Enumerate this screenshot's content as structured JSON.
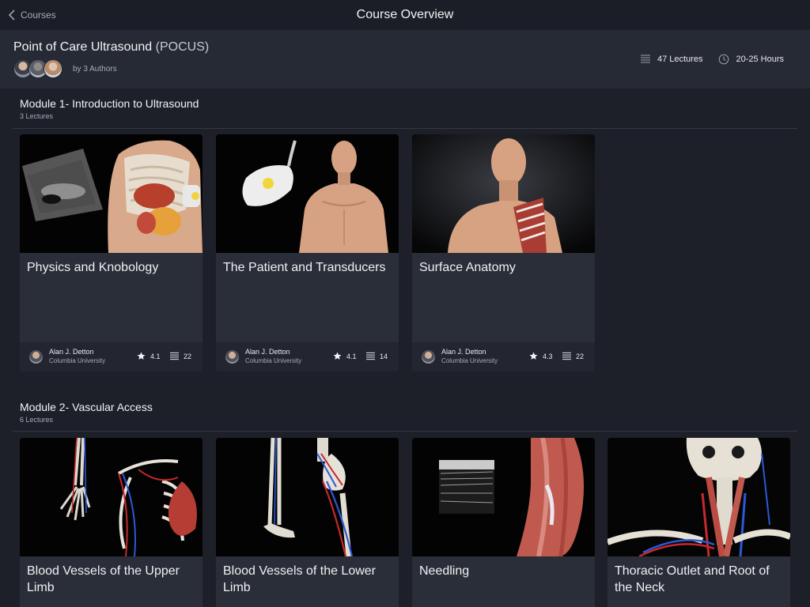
{
  "nav": {
    "back_label": "Courses",
    "title": "Course Overview"
  },
  "course": {
    "title": "Point of Care Ultrasound",
    "acronym": "(POCUS)",
    "authors_label": "by 3 Authors",
    "lectures": "47 Lectures",
    "hours": "20-25 Hours"
  },
  "modules": [
    {
      "title": "Module 1- Introduction to Ultrasound",
      "count": "3 Lectures",
      "cards": [
        {
          "title": "Physics and Knobology",
          "author": "Alan J. Detton",
          "institution": "Columbia University",
          "rating": "4.1",
          "lectures": "22",
          "image": "torso-ultrasound-scan"
        },
        {
          "title": "The Patient and Transducers",
          "author": "Alan J. Detton",
          "institution": "Columbia University",
          "rating": "4.1",
          "lectures": "14",
          "image": "transducer-and-torso"
        },
        {
          "title": "Surface Anatomy",
          "author": "Alan J. Detton",
          "institution": "Columbia University",
          "rating": "4.3",
          "lectures": "22",
          "image": "male-bust-ribcage"
        }
      ]
    },
    {
      "title": "Module 2- Vascular Access",
      "count": "6 Lectures",
      "cards": [
        {
          "title": "Blood Vessels of the Upper Limb",
          "image": "upper-limb-vessels"
        },
        {
          "title": "Blood Vessels of the Lower Limb",
          "image": "lower-limb-vessels"
        },
        {
          "title": "Needling",
          "image": "ultrasound-and-arm-muscle"
        },
        {
          "title": "Thoracic Outlet and Root of the Neck",
          "image": "skull-neck-vessels"
        }
      ]
    }
  ],
  "colors": {
    "background": "#1d2029",
    "header": "#262a34",
    "card": "#2a2e38",
    "artery": "#d32a2a",
    "vein": "#2b59d6"
  }
}
